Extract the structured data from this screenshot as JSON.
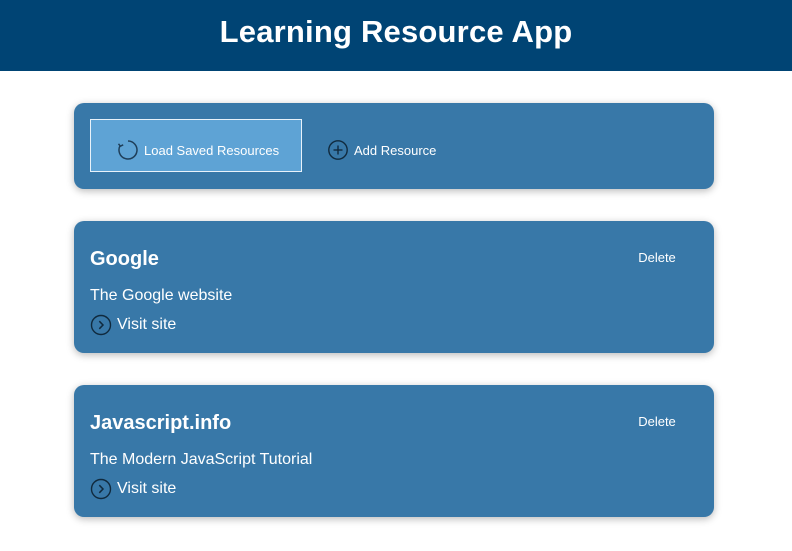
{
  "header": {
    "title": "Learning Resource App"
  },
  "toolbar": {
    "tabs": [
      {
        "label": "Load Saved Resources",
        "icon": "refresh-icon",
        "active": true
      },
      {
        "label": "Add Resource",
        "icon": "add-circle-icon",
        "active": false
      }
    ]
  },
  "resources": [
    {
      "title": "Google",
      "description": "The Google website",
      "delete_label": "Delete",
      "link_label": "Visit site",
      "link_icon": "chevron-right-circle-icon"
    },
    {
      "title": "Javascript.info",
      "description": "The Modern JavaScript Tutorial",
      "delete_label": "Delete",
      "link_label": "Visit site",
      "link_icon": "chevron-right-circle-icon"
    }
  ],
  "colors": {
    "header_bg": "#004474",
    "card_bg": "#3878a8",
    "active_tab_bg": "#5ea3d5",
    "text": "#ffffff"
  }
}
